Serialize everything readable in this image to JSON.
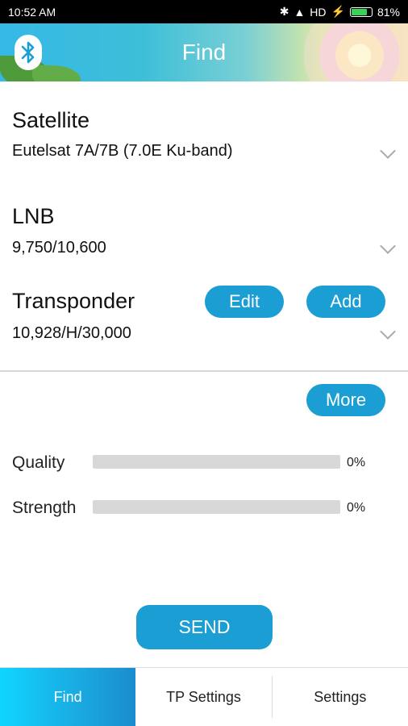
{
  "status_bar": {
    "time": "10:52 AM",
    "network": "HD",
    "battery_percent": "81%",
    "battery_level": 0.81
  },
  "header": {
    "title": "Find",
    "bluetooth_icon": "bluetooth-icon"
  },
  "satellite": {
    "label": "Satellite",
    "value": "Eutelsat 7A/7B (7.0E Ku-band)"
  },
  "lnb": {
    "label": "LNB",
    "value": "9,750/10,600"
  },
  "transponder": {
    "label": "Transponder",
    "value": "10,928/H/30,000",
    "edit_label": "Edit",
    "add_label": "Add"
  },
  "more_label": "More",
  "meters": {
    "quality": {
      "label": "Quality",
      "value": "0%",
      "level": 0
    },
    "strength": {
      "label": "Strength",
      "value": "0%",
      "level": 0
    }
  },
  "send_label": "SEND",
  "tabs": [
    {
      "label": "Find",
      "active": true
    },
    {
      "label": "TP Settings",
      "active": false
    },
    {
      "label": "Settings",
      "active": false
    }
  ],
  "colors": {
    "accent": "#1a9ed4",
    "status_bar": "#000000"
  }
}
